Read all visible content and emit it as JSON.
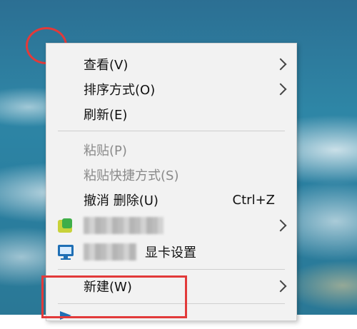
{
  "menu": {
    "items": [
      {
        "label": "查看(V)",
        "submenu": true
      },
      {
        "label": "排序方式(O)",
        "submenu": true
      },
      {
        "label": "刷新(E)"
      },
      {
        "label": "粘贴(P)",
        "disabled": true
      },
      {
        "label": "粘贴快捷方式(S)",
        "disabled": true
      },
      {
        "label": "撤消 删除(U)",
        "shortcut": "Ctrl+Z"
      },
      {
        "label": "",
        "submenu": true,
        "icon": "green-app-icon"
      },
      {
        "label": "显卡设置",
        "icon": "display-settings-icon"
      },
      {
        "label": "新建(W)",
        "submenu": true
      }
    ]
  },
  "colors": {
    "annotation": "#e23a3a",
    "menu_bg": "#f2f2f2"
  }
}
